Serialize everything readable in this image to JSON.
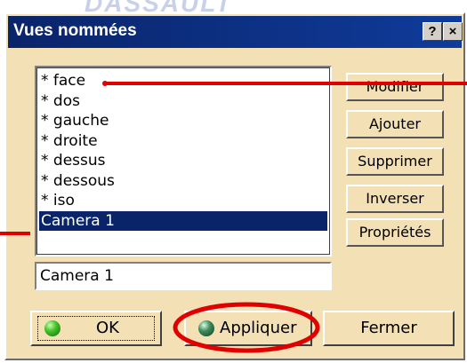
{
  "watermark": "DASSAULT",
  "dialog": {
    "title": "Vues nommées",
    "help_label": "?",
    "close_label": "×"
  },
  "views": {
    "items": [
      "* face",
      "* dos",
      "* gauche",
      "* droite",
      "* dessus",
      "* dessous",
      "* iso",
      "Camera  1"
    ],
    "selected_index": 7,
    "name_field_value": "Camera  1"
  },
  "side_buttons": {
    "modify": "Modifier",
    "add": "Ajouter",
    "delete": "Supprimer",
    "invert": "Inverser",
    "properties": "Propriétés"
  },
  "bottom_buttons": {
    "ok": "OK",
    "apply": "Appliquer",
    "close": "Fermer"
  },
  "colors": {
    "dialog_background": "#f3e0b4",
    "title_bar": "#0a246a",
    "selection": "#0a246a",
    "annotation": "#e00000"
  }
}
